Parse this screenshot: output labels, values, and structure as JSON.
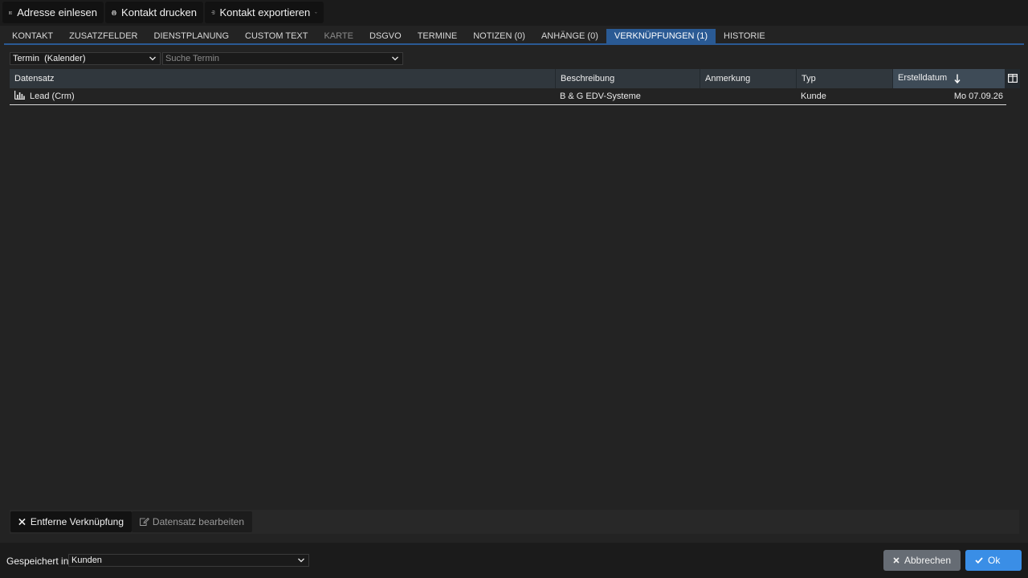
{
  "toolbar": {
    "read_address": "Adresse einlesen",
    "print_contact": "Kontakt drucken",
    "export_contact": "Kontakt exportieren"
  },
  "tabs": [
    {
      "label": "KONTAKT",
      "state": "normal"
    },
    {
      "label": "ZUSATZFELDER",
      "state": "normal"
    },
    {
      "label": "DIENSTPLANUNG",
      "state": "normal"
    },
    {
      "label": "CUSTOM TEXT",
      "state": "normal"
    },
    {
      "label": "KARTE",
      "state": "disabled"
    },
    {
      "label": "DSGVO",
      "state": "normal"
    },
    {
      "label": "TERMINE",
      "state": "normal"
    },
    {
      "label": "NOTIZEN (0)",
      "state": "normal"
    },
    {
      "label": "ANHÄNGE (0)",
      "state": "normal"
    },
    {
      "label": "VERKNÜPFUNGEN (1)",
      "state": "active"
    },
    {
      "label": "HISTORIE",
      "state": "normal"
    }
  ],
  "filter": {
    "type_value": "Termin  (Kalender)",
    "search_placeholder": "Suche Termin"
  },
  "table": {
    "columns": {
      "datensatz": "Datensatz",
      "beschreibung": "Beschreibung",
      "anmerkung": "Anmerkung",
      "typ": "Typ",
      "erstelldatum": "Erstelldatum"
    },
    "sorted_column": "Erstelldatum",
    "sort_direction": "descending",
    "rows": [
      {
        "icon": "bar-chart-icon",
        "datensatz": "Lead (Crm)",
        "beschreibung": "B & G EDV-Systeme",
        "anmerkung": "",
        "typ": "Kunde",
        "erstelldatum": "Mo 07.09.26"
      }
    ]
  },
  "actions": {
    "remove_link": "Entferne Verknüpfung",
    "edit_record": "Datensatz bearbeiten"
  },
  "footer": {
    "saved_in_label": "Gespeichert in",
    "saved_in_value": "Kunden",
    "cancel": "Abbrechen",
    "ok": "Ok"
  },
  "colors": {
    "accent": "#2a5a94",
    "ok_button": "#3a8ee6",
    "cancel_button": "#666c74",
    "header_bg": "#30373d",
    "sorted_header_bg": "#3e4b57"
  }
}
